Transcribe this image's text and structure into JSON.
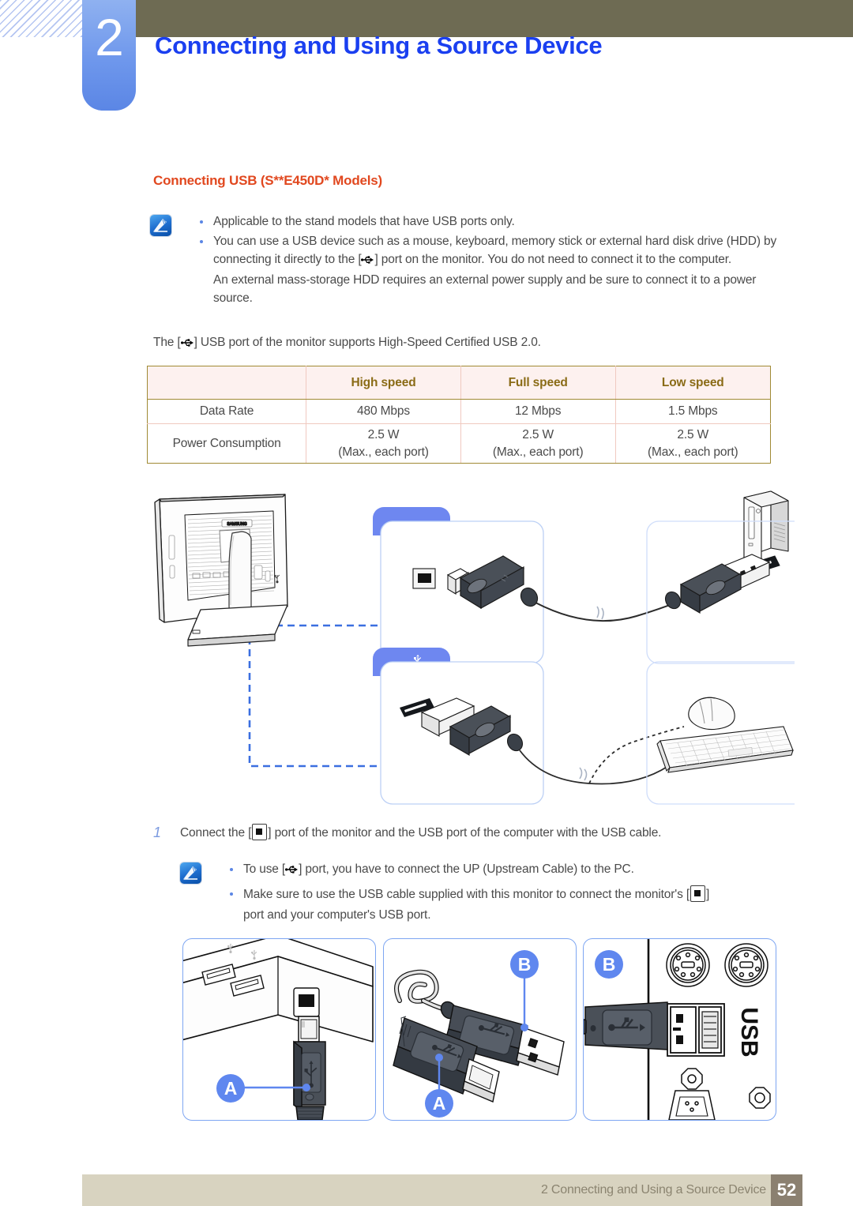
{
  "header": {
    "chapter_number": "2",
    "chapter_title": "Connecting and Using a Source Device"
  },
  "section": {
    "heading": "Connecting USB (S**E450D* Models)"
  },
  "note_top": {
    "icon": "note-pen-icon",
    "items": [
      "Applicable to the stand models that have USB ports only.",
      "You can use a USB device such as a mouse, keyboard, memory stick or external hard disk drive (HDD) by connecting it directly to the [",
      "] port on the monitor. You do not need to connect it to the computer.",
      "An external mass-storage HDD requires an external power supply and be sure to connect it to a power source."
    ],
    "item1": "Applicable to the stand models that have USB ports only.",
    "item2_a": "You can use a USB device such as a mouse, keyboard, memory stick or external hard disk drive (HDD) by connecting it directly to the [",
    "item2_b": "] port on the monitor. You do not need to connect it to the computer.",
    "item2_c": "An external mass-storage HDD requires an external power supply and be sure to connect it to a power source."
  },
  "intro_paragraph": {
    "before": "The [",
    "after": "] USB port of the monitor supports High-Speed Certified USB 2.0."
  },
  "table": {
    "columns": [
      "",
      "High speed",
      "Full speed",
      "Low speed"
    ],
    "rows": [
      {
        "label": "Data Rate",
        "values": [
          "480 Mbps",
          "12 Mbps",
          "1.5 Mbps"
        ]
      },
      {
        "label": "Power Consumption",
        "values": [
          "2.5 W\n(Max., each port)",
          "2.5 W\n(Max., each port)",
          "2.5 W\n(Max., each port)"
        ],
        "value_line1": "2.5 W",
        "value_line2": "(Max., each port)"
      }
    ]
  },
  "diagram": {
    "panel1_tab_label": "",
    "panel2_tab_label": "usb-icon",
    "devices": [
      "monitor-back",
      "computer-tower",
      "usb-b-connector",
      "usb-a-connector",
      "mouse",
      "keyboard"
    ]
  },
  "step": {
    "number": "1",
    "text_a": "Connect the [",
    "text_b": "] port of the monitor and the USB port of the computer with the USB cable."
  },
  "note_bottom": {
    "icon": "note-pen-icon",
    "item1_a": "To use [",
    "item1_b": "] port, you have to connect the UP (Upstream Cable) to the PC.",
    "item2_a": "Make sure to use the USB cable supplied with this monitor to connect the monitor's [",
    "item2_b": "]",
    "item2_c": "port and your computer's USB port."
  },
  "bottom_panels": {
    "panel_a_badge": "A",
    "panel_b_badge_upper": "B",
    "panel_b_badge_lower": "A",
    "panel_c_badge": "B",
    "panel_c_label": "USB"
  },
  "footer": {
    "text": "2 Connecting and Using a Source Device",
    "page": "52"
  },
  "colors": {
    "chapter_blue": "#1a3ff0",
    "tab_blue": "#5b86e5",
    "heading_orange": "#e1481f",
    "olive": "#6e6b53",
    "table_header_bg": "#fdf1ef",
    "table_header_text": "#8a6b16",
    "footer_bar": "#d8d3c0",
    "footer_box": "#8b8070"
  }
}
